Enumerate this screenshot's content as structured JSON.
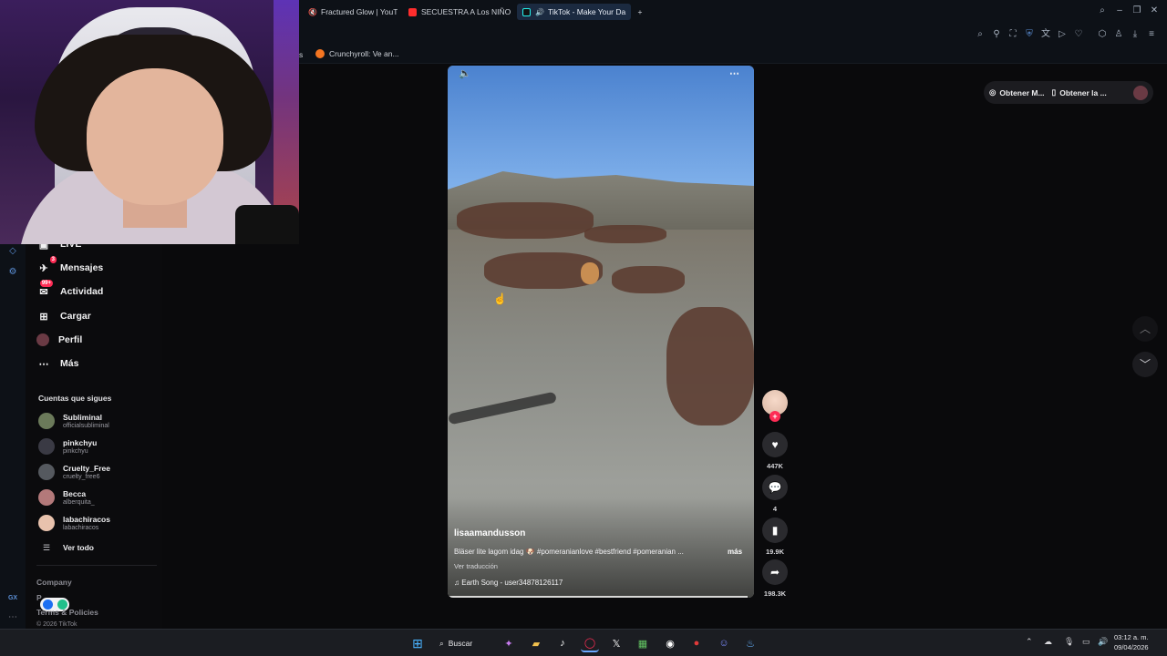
{
  "browser": {
    "tabs": [
      {
        "label": "Fractured Glow | YouT",
        "favicon_color": "#8e95a3",
        "active": false
      },
      {
        "label": "SECUESTRA A Los NIÑOS",
        "favicon_color": "#ff2d2d",
        "active": false
      },
      {
        "label": "TikTok - Make Your Da",
        "favicon_color": "#25f4ee",
        "active": true
      }
    ],
    "new_tab_symbol": "+",
    "bookmarks": [
      {
        "label": "s",
        "favicon_color": "#8e95a3"
      },
      {
        "label": "Crunchyroll: Ve an...",
        "favicon_color": "#f47521"
      }
    ]
  },
  "sidebar_nav": {
    "items": [
      {
        "label": "LIVE",
        "icon": "live-icon"
      },
      {
        "label": "Mensajes",
        "icon": "messages-icon",
        "badge": "3"
      },
      {
        "label": "Actividad",
        "icon": "activity-icon",
        "badge": "99+"
      },
      {
        "label": "Cargar",
        "icon": "upload-icon"
      },
      {
        "label": "Perfil",
        "icon": "profile-icon"
      },
      {
        "label": "Más",
        "icon": "more-icon"
      }
    ],
    "following_title": "Cuentas que sigues",
    "following": [
      {
        "name": "Subliminal",
        "handle": "officialsubliminal",
        "color": "#6b7a5a"
      },
      {
        "name": "pinkchyu",
        "handle": "pinkchyu",
        "color": "#3a3a44"
      },
      {
        "name": "Cruelty_Free",
        "handle": "cruelty_free6",
        "color": "#55595f"
      },
      {
        "name": "Becca",
        "handle": "alberquita_",
        "color": "#b3797a"
      },
      {
        "name": "labachiracos",
        "handle": "labachiracos",
        "color": "#e8c2ad"
      }
    ],
    "see_all": "Ver todo",
    "footer": {
      "company": "Company",
      "program": "P",
      "terms": "Terms & Policies",
      "copyright": "© 2026 TikTok"
    }
  },
  "video": {
    "author": "lisaamandusson",
    "description": "Bläser lite lagom idag 🐶 #pomeranianlove #bestfriend #pomeranian ...",
    "more_label": "más",
    "translation_label": "Ver traducción",
    "song": "Earth Song - user34878126117",
    "progress": 0.98
  },
  "actions": {
    "likes": "447K",
    "comments": "4",
    "saves": "19.9K",
    "shares": "198.3K"
  },
  "get_app": {
    "item1": "Obtener M...",
    "item2": "Obtener la ..."
  },
  "taskbar": {
    "search_label": "Buscar",
    "time": "03:12 a. m.",
    "date": "09/04/2026"
  },
  "vsidebar_label": "GX"
}
